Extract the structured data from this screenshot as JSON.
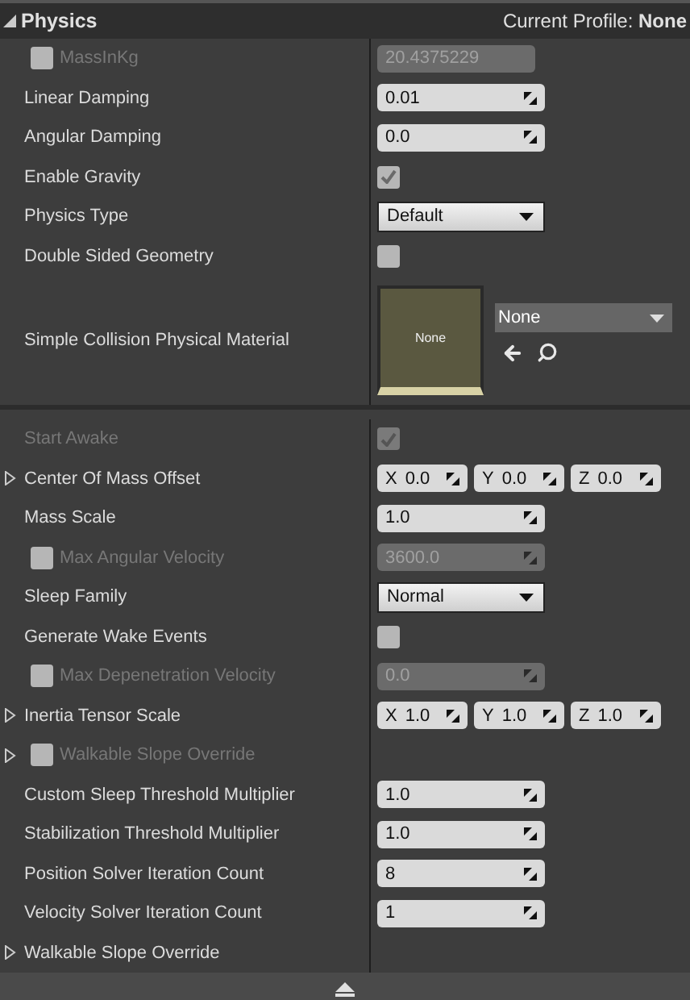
{
  "header": {
    "title": "Physics",
    "expanded": true,
    "profile": "Current Profile: **None**"
  },
  "sections": [
    {
      "rows": [
        {
          "kind": "readonly",
          "label": "MassInKg",
          "disabled": true,
          "override_checked": false,
          "value": "20.4375229"
        },
        {
          "kind": "number",
          "label": "Linear Damping",
          "disabled": false,
          "value": "0.01"
        },
        {
          "kind": "number",
          "label": "Angular Damping",
          "disabled": false,
          "value": "0.0"
        },
        {
          "kind": "checkbox",
          "label": "Enable Gravity",
          "disabled": false,
          "checked": true
        },
        {
          "kind": "dropdown",
          "label": "Physics Type",
          "disabled": false,
          "value": "Default"
        },
        {
          "kind": "checkbox",
          "label": "Double Sided Geometry",
          "disabled": false,
          "checked": false
        },
        {
          "kind": "asset",
          "label": "Simple Collision Physical Material",
          "disabled": false,
          "thumbnail_label": "None",
          "value": "None"
        }
      ]
    },
    {
      "rows": [
        {
          "kind": "checkbox",
          "label": "Start Awake",
          "disabled": true,
          "checked": true
        },
        {
          "kind": "vector",
          "label": "Center Of Mass Offset",
          "disabled": false,
          "expanded": false,
          "components": [
            {
              "axis": "X",
              "value": "0.0"
            },
            {
              "axis": "Y",
              "value": "0.0"
            },
            {
              "axis": "Z",
              "value": "0.0"
            }
          ]
        },
        {
          "kind": "number",
          "label": "Mass Scale",
          "disabled": false,
          "value": "1.0"
        },
        {
          "kind": "number",
          "label": "Max Angular Velocity",
          "disabled": true,
          "override_checked": false,
          "value": "3600.0"
        },
        {
          "kind": "dropdown",
          "label": "Sleep Family",
          "disabled": false,
          "value": "Normal"
        },
        {
          "kind": "checkbox",
          "label": "Generate Wake Events",
          "disabled": false,
          "checked": false
        },
        {
          "kind": "number",
          "label": "Max Depenetration Velocity",
          "disabled": true,
          "override_checked": false,
          "value": "0.0"
        },
        {
          "kind": "vector",
          "label": "Inertia Tensor Scale",
          "disabled": false,
          "expanded": false,
          "components": [
            {
              "axis": "X",
              "value": "1.0"
            },
            {
              "axis": "Y",
              "value": "1.0"
            },
            {
              "axis": "Z",
              "value": "1.0"
            }
          ]
        },
        {
          "kind": "group",
          "label": "Walkable Slope Override",
          "disabled": true,
          "expanded": false,
          "override_checked": false
        },
        {
          "kind": "number",
          "label": "Custom Sleep Threshold Multiplier",
          "disabled": false,
          "value": "1.0"
        },
        {
          "kind": "number",
          "label": "Stabilization Threshold Multiplier",
          "disabled": false,
          "value": "1.0"
        },
        {
          "kind": "number",
          "label": "Position Solver Iteration Count",
          "disabled": false,
          "value": "8"
        },
        {
          "kind": "number",
          "label": "Velocity Solver Iteration Count",
          "disabled": false,
          "value": "1"
        },
        {
          "kind": "group",
          "label": "Walkable Slope Override",
          "disabled": false,
          "expanded": false
        }
      ]
    }
  ]
}
